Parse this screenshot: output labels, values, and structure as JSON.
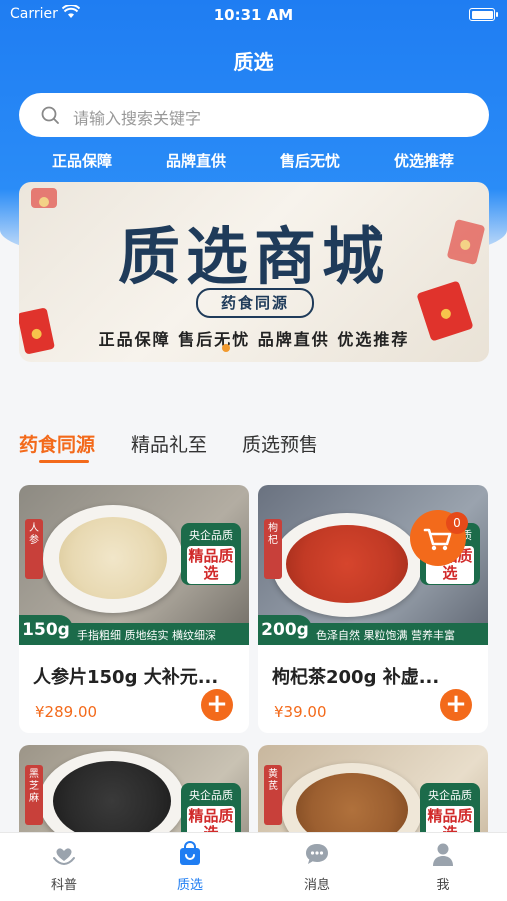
{
  "status_bar": {
    "carrier": "Carrier",
    "time": "10:31 AM"
  },
  "nav": {
    "title": "质选"
  },
  "search": {
    "placeholder": "请输入搜索关键字"
  },
  "features": [
    "正品保障",
    "品牌直供",
    "售后无忧",
    "优选推荐"
  ],
  "banner": {
    "title": "质选商城",
    "subtitle": "药食同源",
    "tagline": "正品保障 售后无忧 品牌直供 优选推荐"
  },
  "tabs": [
    {
      "label": "药食同源",
      "active": true
    },
    {
      "label": "精品礼至",
      "active": false
    },
    {
      "label": "质选预售",
      "active": false
    }
  ],
  "products": [
    {
      "name": "人参片150g 大补元...",
      "price": "¥289.00",
      "badge_top": "央企品质",
      "badge_main": "精品质选",
      "side_tag": "人参",
      "weight": "150g",
      "desc": "手指粗细 质地结实 横纹细深"
    },
    {
      "name": "枸杞茶200g 补虚...",
      "price": "¥39.00",
      "badge_top": "央企品质",
      "badge_main": "精品质选",
      "side_tag": "枸杞",
      "weight": "200g",
      "desc": "色泽自然 果粒饱满 营养丰富"
    },
    {
      "badge_top": "央企品质",
      "badge_main": "精品质选",
      "side_tag": "黑芝麻"
    },
    {
      "badge_top": "央企品质",
      "badge_main": "精品质选",
      "side_tag": "黄芪"
    }
  ],
  "cart": {
    "count": "0"
  },
  "tabbar": [
    {
      "label": "科普",
      "icon": "heart-hand-icon",
      "active": false
    },
    {
      "label": "质选",
      "icon": "shopping-bag-icon",
      "active": true
    },
    {
      "label": "消息",
      "icon": "chat-bubble-icon",
      "active": false
    },
    {
      "label": "我",
      "icon": "person-icon",
      "active": false
    }
  ],
  "colors": {
    "primary": "#1f7df2",
    "accent": "#f36a1b",
    "badge_green": "#1c6b4a"
  }
}
